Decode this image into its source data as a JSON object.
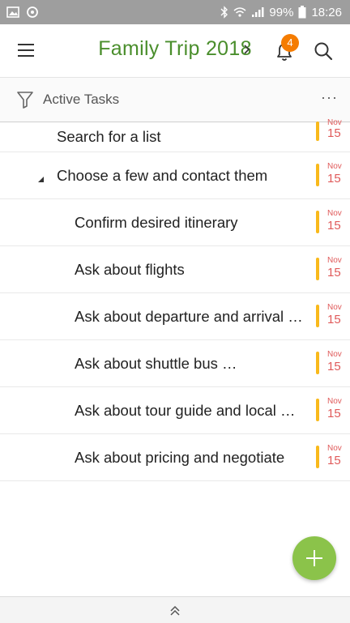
{
  "status_bar": {
    "battery": "99%",
    "time": "18:26",
    "icons": [
      "image-icon",
      "sync-icon",
      "bluetooth-icon",
      "wifi-icon",
      "signal-icon",
      "battery-icon"
    ]
  },
  "header": {
    "title": "Family Trip 2018",
    "notification_count": "4",
    "title_color": "#4a8e2c",
    "badge_color": "#f57c00"
  },
  "filter": {
    "label": "Active Tasks",
    "more": "···"
  },
  "tasks": [
    {
      "text": "Search for a list",
      "month": "Nov",
      "day": "15"
    },
    {
      "text": "Choose a few and contact them",
      "month": "Nov",
      "day": "15"
    },
    {
      "text": "Confirm desired itinerary",
      "month": "Nov",
      "day": "15"
    },
    {
      "text": "Ask about flights",
      "month": "Nov",
      "day": "15"
    },
    {
      "text": "Ask about departure and arrival …",
      "month": "Nov",
      "day": "15"
    },
    {
      "text": "Ask about shuttle bus …",
      "month": "Nov",
      "day": "15"
    },
    {
      "text": "Ask about tour guide and local …",
      "month": "Nov",
      "day": "15"
    },
    {
      "text": "Ask about pricing and negotiate",
      "month": "Nov",
      "day": "15"
    }
  ],
  "colors": {
    "due_bar": "#f9b91b",
    "due_text": "#e05a5a",
    "fab": "#8bc34a"
  }
}
